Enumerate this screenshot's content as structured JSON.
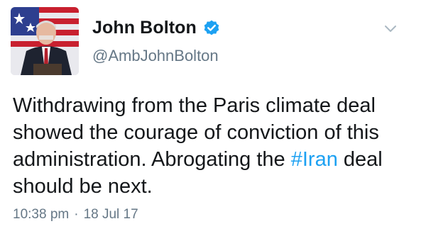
{
  "user": {
    "display_name": "John Bolton",
    "handle": "@AmbJohnBolton",
    "verified": true
  },
  "icons": {
    "verified": "verified-badge-icon",
    "menu": "chevron-down-icon",
    "avatar": "profile-photo"
  },
  "tweet": {
    "text_before_hashtag": "Withdrawing from the Paris climate deal showed the courage of conviction of this administration. Abrogating the ",
    "hashtag": "#Iran",
    "text_after_hashtag": " deal should be next."
  },
  "meta": {
    "time": "10:38 pm",
    "separator": "·",
    "date": "18 Jul 17"
  },
  "colors": {
    "link": "#1da1f2",
    "secondary_text": "#657786",
    "primary_text": "#14171a"
  }
}
